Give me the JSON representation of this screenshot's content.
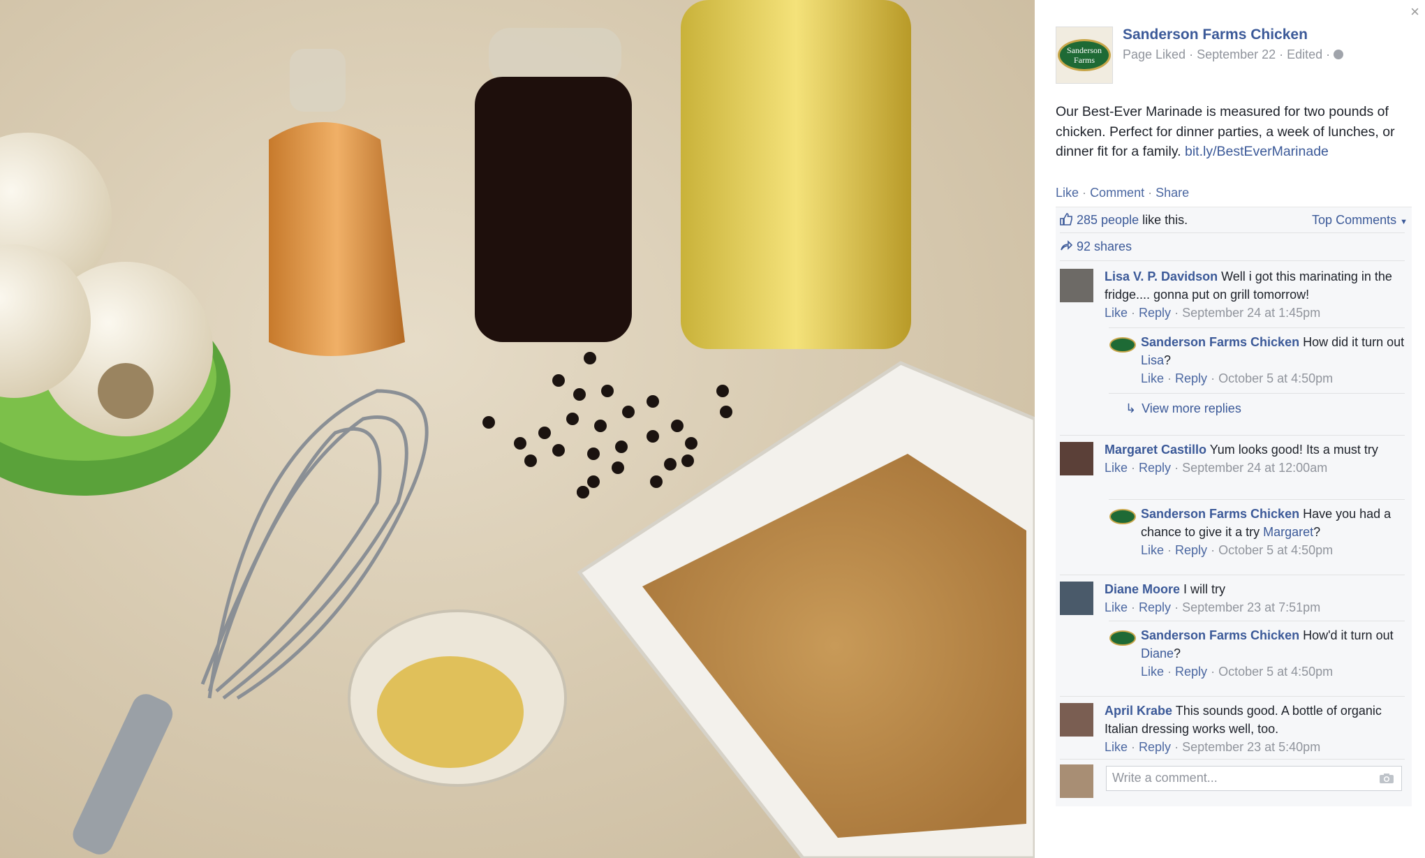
{
  "post": {
    "page_name": "Sanderson Farms Chicken",
    "meta": "Page Liked · September 22 · Edited ·",
    "logo_text": "Sanderson Farms",
    "text": "Our Best-Ever Marinade is measured for two pounds of chicken. Perfect for dinner parties, a week of lunches, or dinner fit for a family.",
    "link": "bit.ly/BestEverMarinade",
    "actions": {
      "like": "Like",
      "comment": "Comment",
      "share": "Share"
    }
  },
  "stats": {
    "likes_link": "285 people",
    "likes_suffix": "like this.",
    "top_comments": "Top Comments",
    "shares": "92 shares"
  },
  "comments": [
    {
      "author": "Lisa V. P. Davidson",
      "text": "Well i got this marinating in the fridge.... gonna put on grill tomorrow!",
      "like": "Like",
      "reply": "Reply",
      "date": "September 24 at 1:45pm",
      "reply_item": {
        "author": "Sanderson Farms Chicken",
        "text_before": "How did it turn out",
        "mention": "Lisa",
        "text_after": "?",
        "like": "Like",
        "reply": "Reply",
        "date": "October 5 at 4:50pm"
      },
      "view_more": "View more replies"
    },
    {
      "author": "Margaret Castillo",
      "text": "Yum looks good! Its a must try",
      "like": "Like",
      "reply": "Reply",
      "date": "September 24 at 12:00am",
      "reply_item": {
        "author": "Sanderson Farms Chicken",
        "text_before": "Have you had a chance to give it a try",
        "mention": "Margaret",
        "text_after": "?",
        "like": "Like",
        "reply": "Reply",
        "date": "October 5 at 4:50pm"
      }
    },
    {
      "author": "Diane Moore",
      "text": "I will try",
      "like": "Like",
      "reply": "Reply",
      "date": "September 23 at 7:51pm",
      "reply_item": {
        "author": "Sanderson Farms Chicken",
        "text_before": "How'd it turn out",
        "mention": "Diane",
        "text_after": "?",
        "like": "Like",
        "reply": "Reply",
        "date": "October 5 at 4:50pm"
      }
    },
    {
      "author": "April Krabe",
      "text": "This sounds good. A bottle of organic Italian dressing works well, too.",
      "like": "Like",
      "reply": "Reply",
      "date": "September 23 at 5:40pm"
    }
  ],
  "composer": {
    "placeholder": "Write a comment..."
  },
  "colors": {
    "link": "#3b5998",
    "meta": "#90949c",
    "panel_bg": "#f6f7f9"
  }
}
